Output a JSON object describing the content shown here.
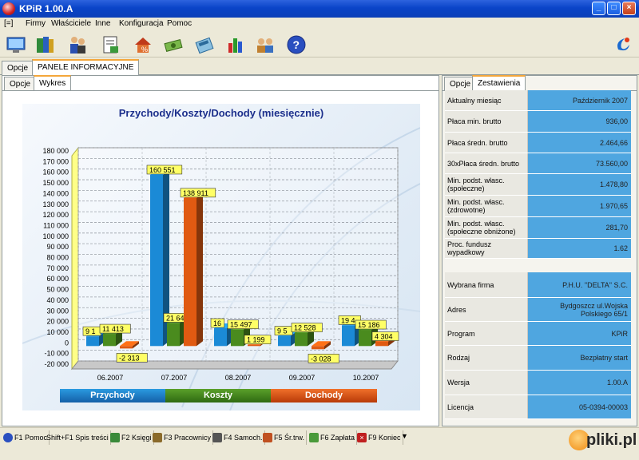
{
  "window": {
    "title": "KPiR 1.00.A"
  },
  "menu": [
    "[=]",
    "Firmy",
    "Właściciele",
    "Inne",
    "Konfiguracja",
    "Pomoc"
  ],
  "toolbar_icons": [
    "monitor-icon",
    "books-icon",
    "people-icon",
    "invoice-icon",
    "house-percent-icon",
    "money-icon",
    "calculator-icon",
    "bar-chart-icon",
    "users-icon",
    "help-icon",
    "logo-icon"
  ],
  "outer_tabs": [
    "Opcje",
    "PANELE INFORMACYJNE"
  ],
  "left_tabs": [
    "Opcje",
    "Wykres"
  ],
  "right_tabs": [
    "Opcje",
    "Zestawienia"
  ],
  "chart_data": {
    "type": "bar",
    "title": "Przychody/Koszty/Dochody (miesięcznie)",
    "categories": [
      "06.2007",
      "07.2007",
      "08.2007",
      "09.2007",
      "10.2007"
    ],
    "yticks": [
      "180 000",
      "170 000",
      "160 000",
      "150 000",
      "140 000",
      "130 000",
      "120 000",
      "110 000",
      "100 000",
      "90 000",
      "80 000",
      "70 000",
      "60 000",
      "50 000",
      "40 000",
      "30 000",
      "20 000",
      "10 000",
      "0",
      "-10 000",
      "-20 000"
    ],
    "ylim": [
      -20000,
      180000
    ],
    "series": [
      {
        "name": "Przychody",
        "color": "#1b8ad6",
        "values": [
          9100,
          160551,
          16700,
          9500,
          19400
        ],
        "labels": [
          "9 1",
          "160 551",
          "16",
          "9 5",
          "19 4"
        ]
      },
      {
        "name": "Koszty",
        "color": "#4a8b1e",
        "values": [
          11413,
          21640,
          15497,
          12528,
          15186
        ],
        "labels": [
          "11 413",
          "21 640",
          "15 497",
          "12 528",
          "15 186"
        ]
      },
      {
        "name": "Dochody",
        "color": "#e05a12",
        "values": [
          -2313,
          138911,
          1199,
          -3028,
          4304
        ],
        "labels": [
          "-2 313",
          "138 911",
          "1 199",
          "-3 028",
          "4 304"
        ]
      }
    ]
  },
  "summary": [
    {
      "label": "Aktualny miesiąc",
      "value": "Październik 2007"
    },
    {
      "label": "Płaca min. brutto",
      "value": "936,00"
    },
    {
      "label": "Płaca średn. brutto",
      "value": "2.464,66"
    },
    {
      "label": "30xPłaca średn. brutto",
      "value": "73.560,00"
    },
    {
      "label": "Min. podst. własc. (społeczne)",
      "value": "1.478,80"
    },
    {
      "label": "Min. podst. własc. (zdrowotne)",
      "value": "1.970,65"
    },
    {
      "label": "Min. podst. własc. (społeczne obniżone)",
      "value": "281,70"
    },
    {
      "label": "Proc. fundusz wypadkowy",
      "value": "1.62"
    }
  ],
  "firm": [
    {
      "label": "Wybrana firma",
      "value": "P.H.U. \"DELTA\" S.C."
    },
    {
      "label": "Adres",
      "value": "Bydgoszcz ul.Wojska Polskiego 65/1"
    },
    {
      "label": "Program",
      "value": "KPiR"
    },
    {
      "label": "Rodzaj",
      "value": "Bezpłatny start"
    },
    {
      "label": "Wersja",
      "value": "1.00.A"
    },
    {
      "label": "Licencja",
      "value": "05-0394-00003"
    }
  ],
  "fkeys": [
    {
      "label": "F1 Pomoc",
      "icon": "help-icon",
      "color": "#2a4fc0"
    },
    {
      "label": "Shift+F1 Spis treści",
      "icon": "",
      "color": ""
    },
    {
      "label": "F2 Księgi",
      "icon": "books-icon",
      "color": "#3a8a3a"
    },
    {
      "label": "F3 Pracownicy",
      "icon": "people-icon",
      "color": "#8a6a2a"
    },
    {
      "label": "F4 Samoch.",
      "icon": "car-icon",
      "color": "#555555"
    },
    {
      "label": "F5 Śr.trw.",
      "icon": "asset-icon",
      "color": "#c05020"
    },
    {
      "label": "F6 Zapłata",
      "icon": "money-icon",
      "color": "#4a9a3a"
    },
    {
      "label": "F9 Koniec",
      "icon": "exit-icon",
      "color": "#c02020"
    }
  ],
  "watermark": "pliki.pl"
}
